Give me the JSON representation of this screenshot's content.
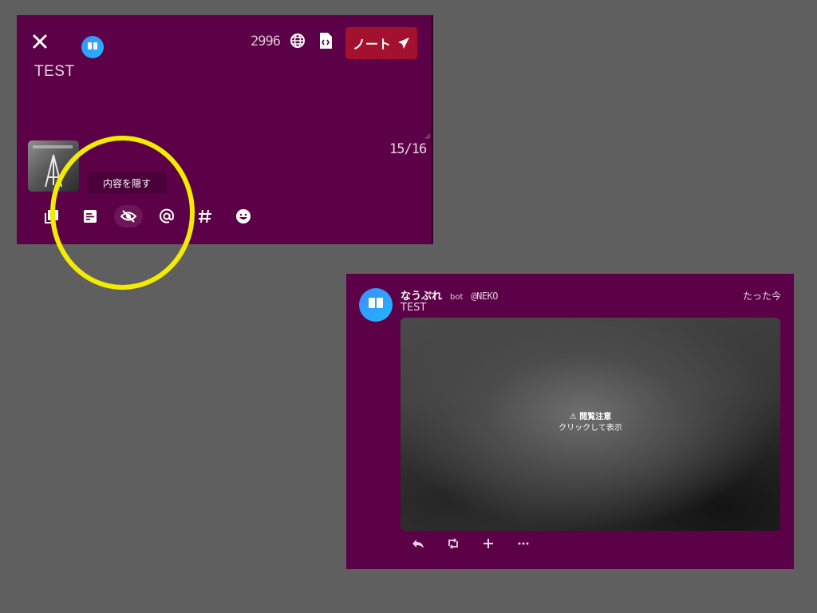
{
  "composer": {
    "char_count": "2996",
    "post_button_label": "ノート",
    "text": "TEST",
    "attachment_ratio": "15/16",
    "tooltip": "内容を隠す",
    "icons": [
      "close-icon",
      "globe-icon",
      "file-code-icon",
      "send-icon"
    ],
    "toolbar": [
      "photo-library-icon",
      "poll-icon",
      "eye-off-icon",
      "at-mention-icon",
      "hashtag-icon",
      "emoji-icon"
    ]
  },
  "note": {
    "username": "なうぷれ",
    "bot_label": "bot",
    "handle": "@NEKO",
    "time": "たった今",
    "text": "TEST",
    "sensitive_title": "閲覧注意",
    "sensitive_hint": "クリックして表示",
    "actions": [
      "reply-icon",
      "renote-icon",
      "plus-icon",
      "more-icon"
    ]
  },
  "colors": {
    "panel": "#5c0047",
    "button": "#a4112e",
    "background": "#5f5f5f",
    "highlight": "#f2ec00"
  }
}
